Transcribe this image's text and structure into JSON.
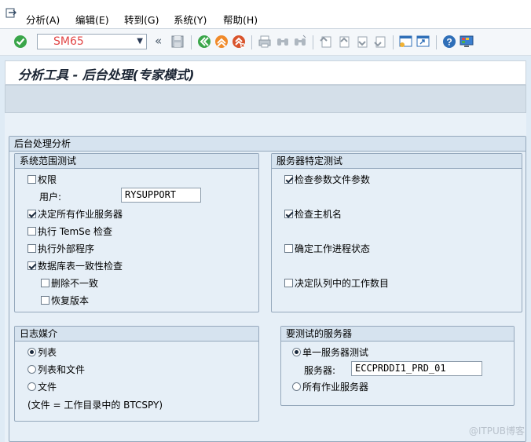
{
  "menubar": {
    "items": [
      "分析(A)",
      "编辑(E)",
      "转到(G)",
      "系统(Y)",
      "帮助(H)"
    ]
  },
  "toolbar": {
    "command_field": "SM65",
    "nav_arrows": "«"
  },
  "title": "分析工具 - 后台处理(专家模式)",
  "main": {
    "outer_group": "后台处理分析",
    "system_tests": {
      "heading": "系统范围测试",
      "permission": {
        "label": "权限",
        "checked": false
      },
      "user_label": "用户:",
      "user_value": "RYSUPPORT",
      "all_servers": {
        "label": "决定所有作业服务器",
        "checked": true
      },
      "temse": {
        "label": "执行 TemSe 检查",
        "checked": false
      },
      "external": {
        "label": "执行外部程序",
        "checked": false
      },
      "db_consistency": {
        "label": "数据库表一致性检查",
        "checked": true
      },
      "delete_inconsistent": {
        "label": "删除不一致",
        "checked": false
      },
      "restore": {
        "label": "恢复版本",
        "checked": false
      }
    },
    "server_tests": {
      "heading": "服务器特定测试",
      "check_params": {
        "label": "检查参数文件参数",
        "checked": true
      },
      "check_host": {
        "label": "检查主机名",
        "checked": true
      },
      "work_process": {
        "label": "确定工作进程状态",
        "checked": false
      },
      "queue_count": {
        "label": "决定队列中的工作数目",
        "checked": false
      }
    },
    "log_media": {
      "heading": "日志媒介",
      "list": {
        "label": "列表",
        "selected": true
      },
      "list_and_file": {
        "label": "列表和文件",
        "selected": false
      },
      "file": {
        "label": "文件",
        "selected": false
      },
      "file_note": "(文件 = 工作目录中的 BTCSPY)"
    },
    "servers_to_test": {
      "heading": "要测试的服务器",
      "single": {
        "label": "单一服务器测试",
        "selected": true
      },
      "server_label": "服务器:",
      "server_value": "ECCPRDDI1_PRD_01",
      "all": {
        "label": "所有作业服务器",
        "selected": false
      }
    }
  },
  "watermark": "@ITPUB博客",
  "colors": {
    "accent_green": "#3aa64a",
    "accent_orange": "#f08a2a",
    "accent_red": "#d9542c",
    "help_blue": "#2f6fb8"
  }
}
